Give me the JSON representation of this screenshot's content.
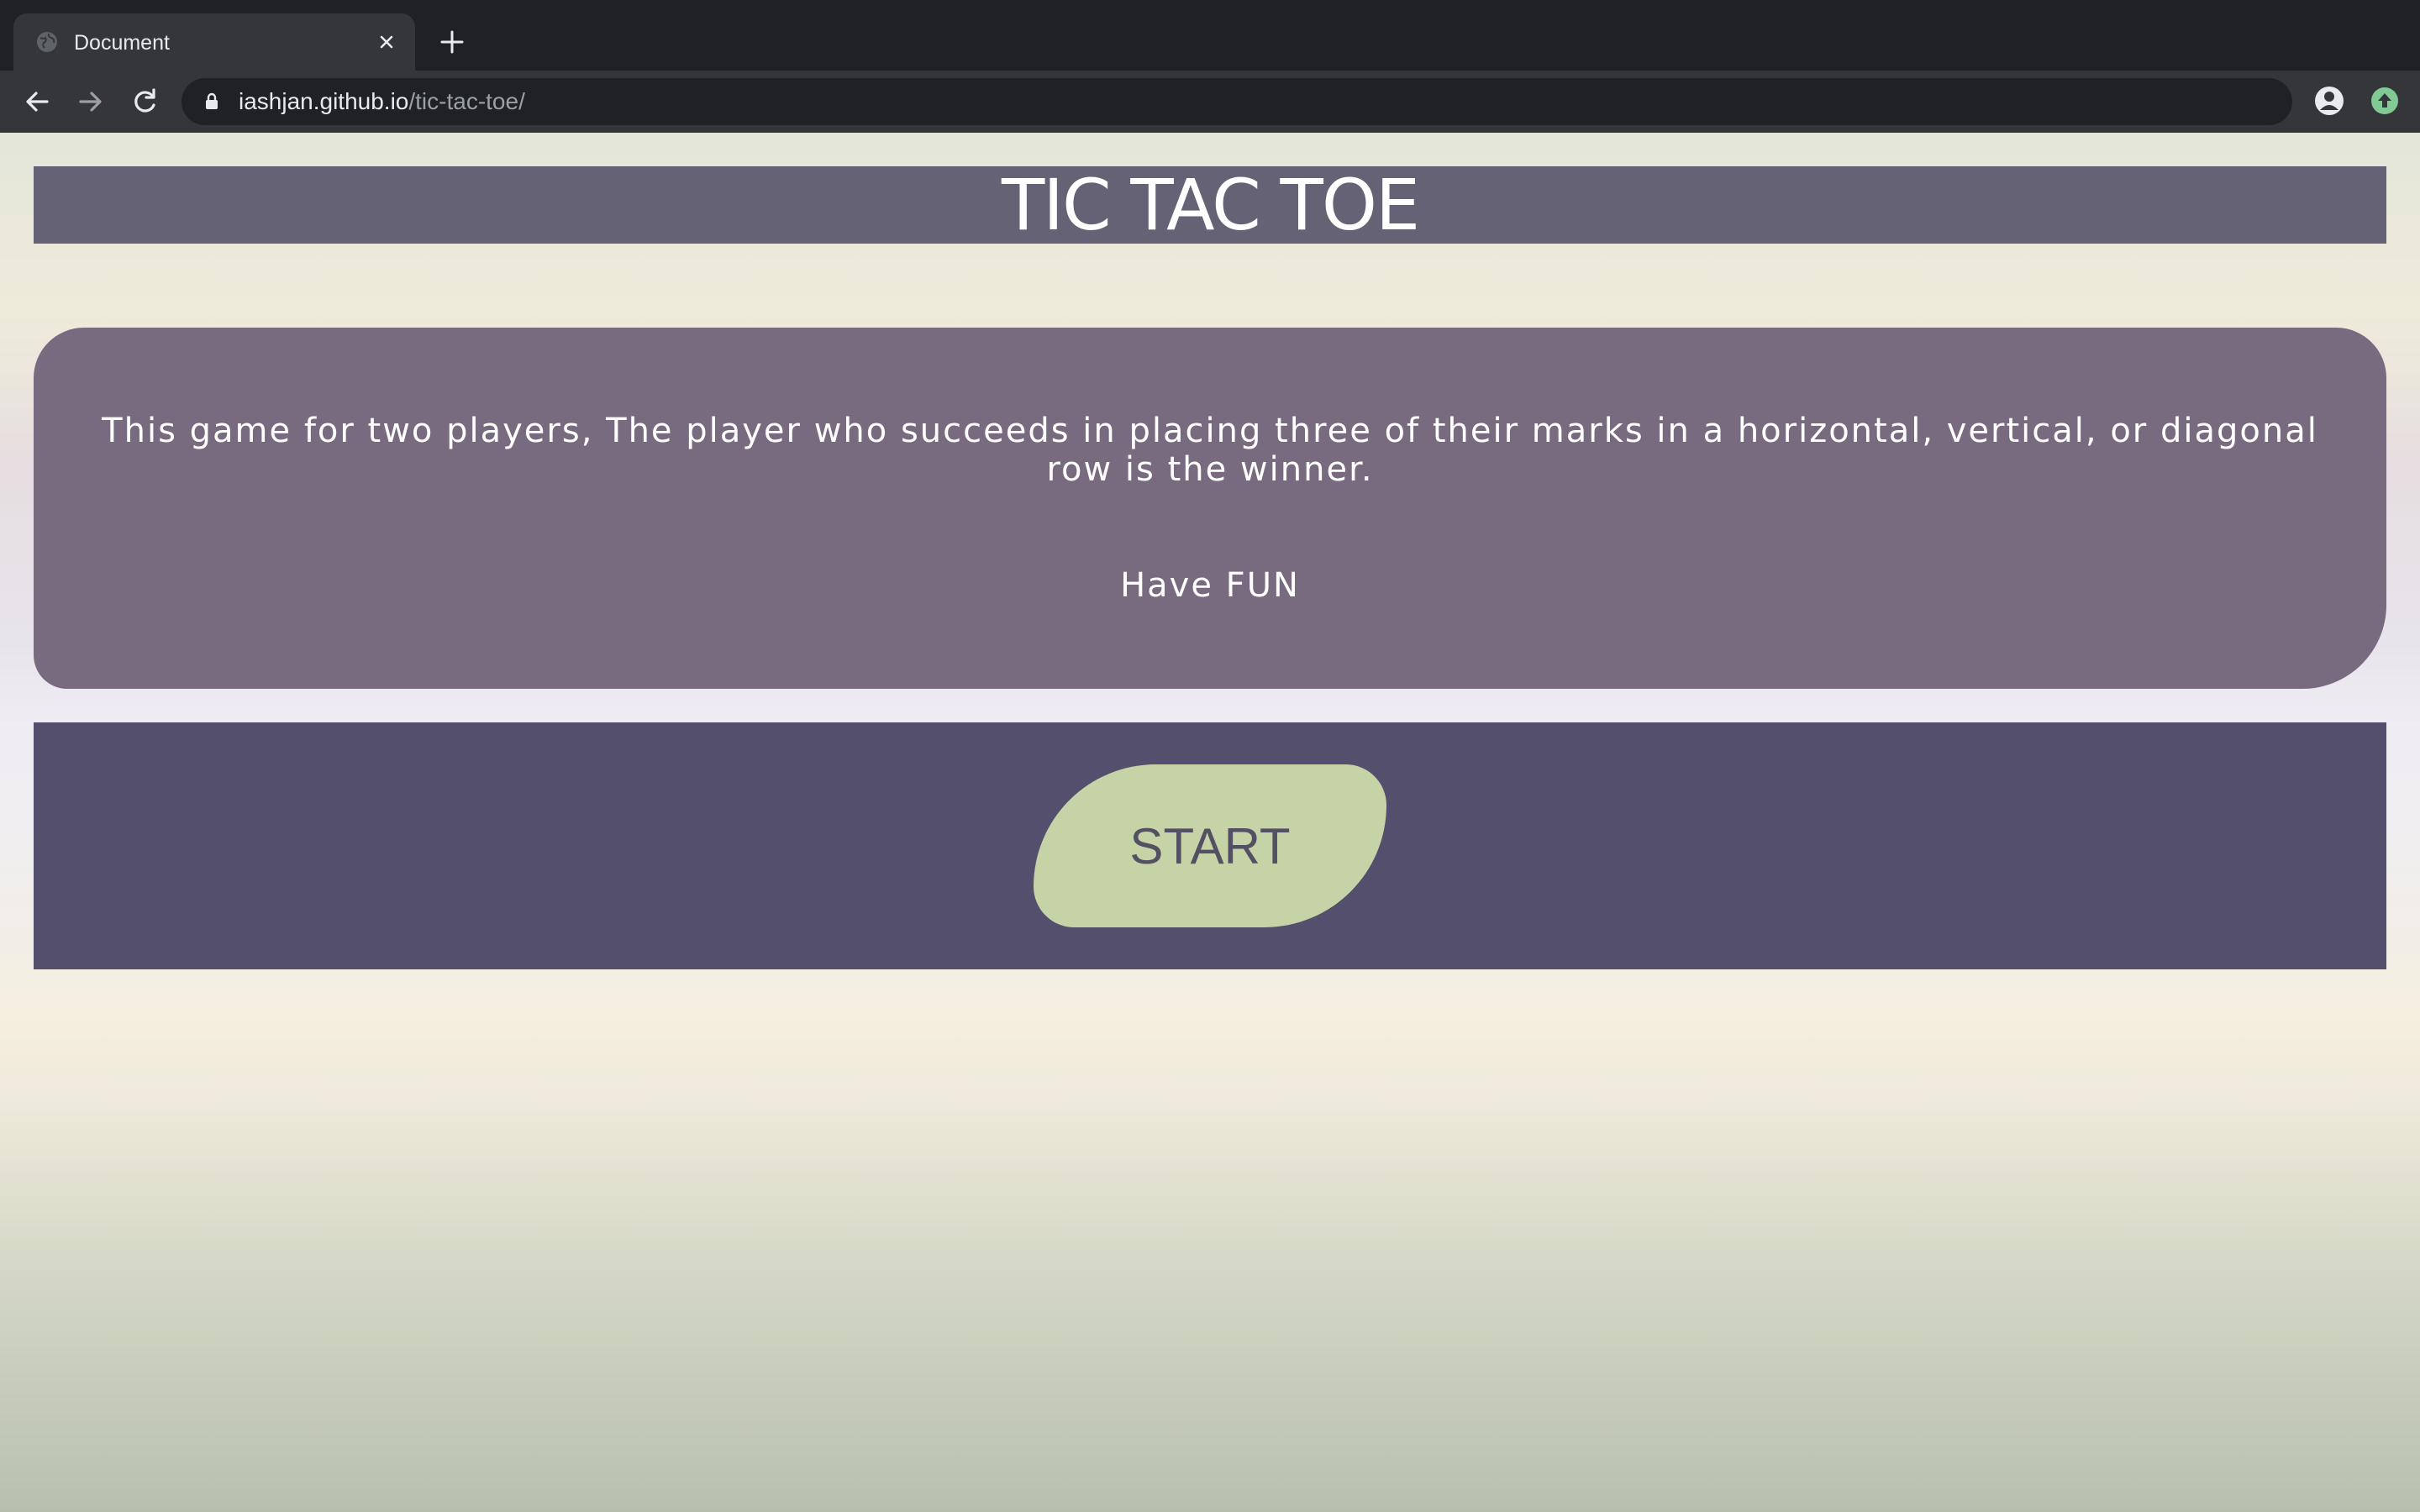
{
  "browser": {
    "tab": {
      "title": "Document",
      "favicon_icon": "globe-icon",
      "close_icon": "close-icon"
    },
    "new_tab_icon": "plus-icon",
    "nav": {
      "back_icon": "arrow-left-icon",
      "forward_icon": "arrow-right-icon",
      "reload_icon": "reload-icon"
    },
    "address_bar": {
      "lock_icon": "lock-icon",
      "url_host": "iashjan.github.io",
      "url_path": "/tic-tac-toe/"
    },
    "bookmark_icon": "star-icon",
    "profile_icon": "account-circle-icon",
    "extension_icon": "update-arrow-icon"
  },
  "page": {
    "title": "TIC TAC TOE",
    "description": "This game for two players, The player who succeeds in placing three of their marks in a horizontal, vertical, or diagonal row is the winner.",
    "tagline": "Have FUN",
    "start_label": "START"
  },
  "colors": {
    "title_bar": "#656275",
    "info_card": "#786b80",
    "start_panel": "#534f6c",
    "start_button": "#c6d3a6",
    "start_text": "#535063"
  }
}
